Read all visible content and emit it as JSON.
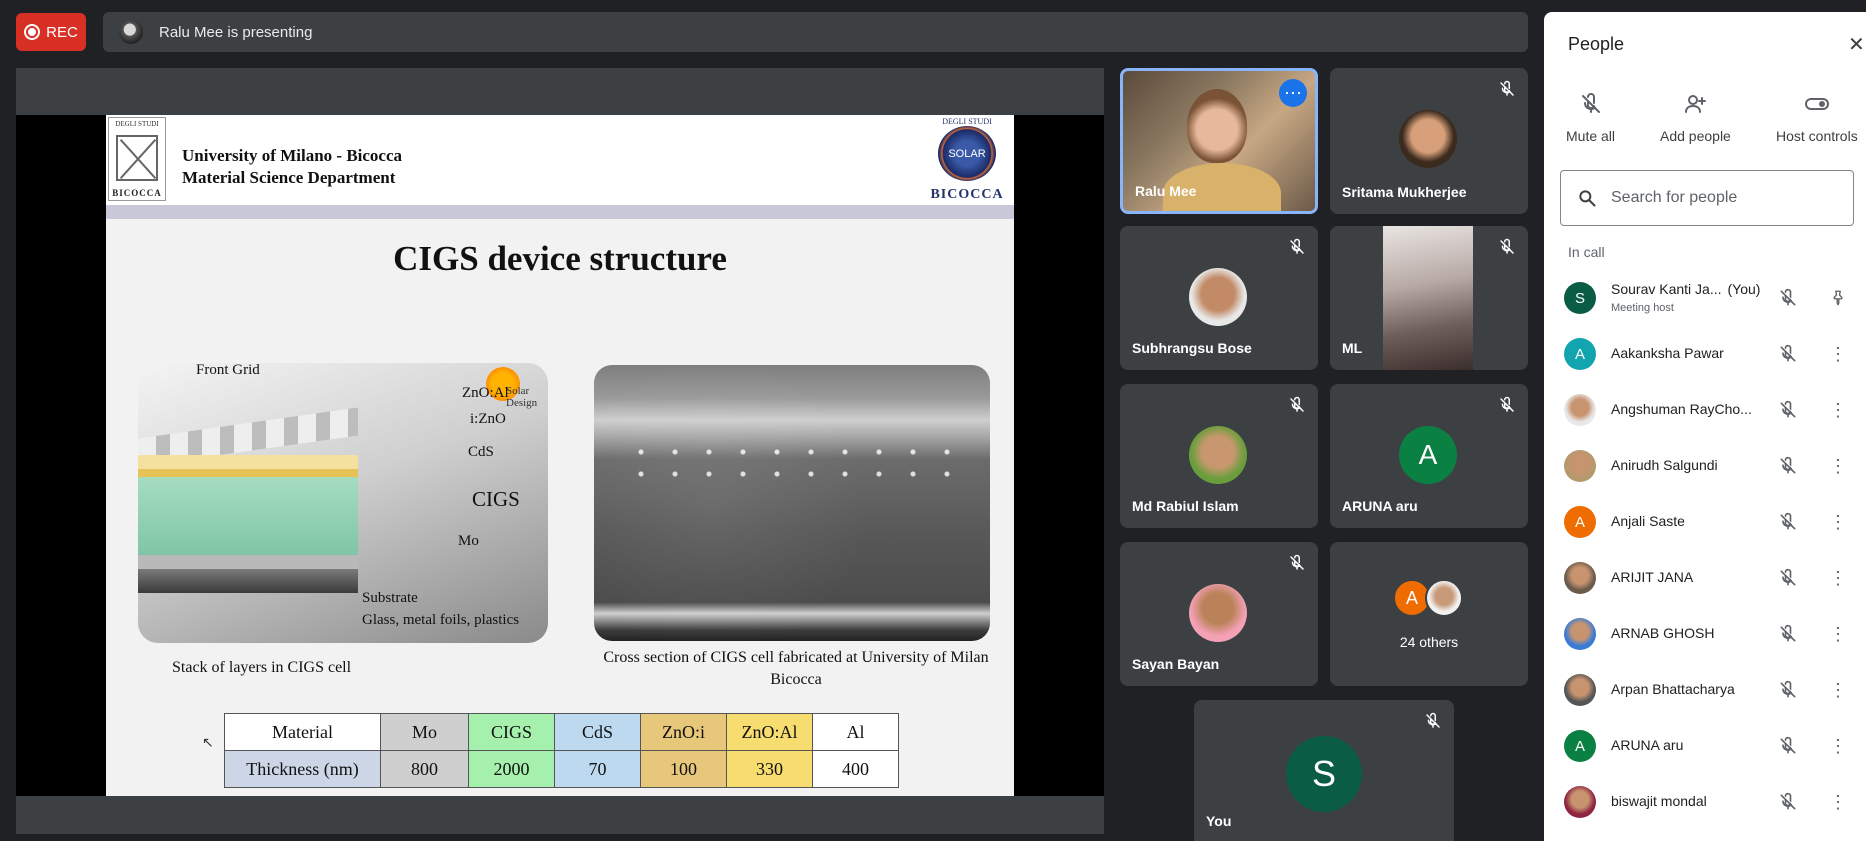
{
  "top_bar": {
    "rec_label": "REC",
    "presenting_text": "Ralu Mee is presenting"
  },
  "slide": {
    "university": "University of Milano - Bicocca",
    "department": "Material Science Department",
    "logo_left_top": "DEGLI STUDI",
    "logo_left_text": "BICOCCA",
    "logo_right_top": "DEGLI STUDI",
    "logo_right_circle": "SOLAR",
    "logo_right_text": "BICOCCA",
    "title": "CIGS device structure",
    "stack_labels": {
      "front_grid": "Front Grid",
      "zno_al": "ZnO:Al",
      "izno": "i:ZnO",
      "cds": "CdS",
      "cigs": "CIGS",
      "mo": "Mo",
      "substrate": "Substrate",
      "substrate_detail": "Glass, metal foils, plastics",
      "solar_design": "Solar Design"
    },
    "caption_left": "Stack of layers in CIGS cell",
    "caption_right": "Cross section of CIGS cell fabricated at University of Milan Bicocca",
    "table": {
      "header": [
        "Material",
        "Mo",
        "CIGS",
        "CdS",
        "ZnO:i",
        "ZnO:Al",
        "Al"
      ],
      "row": [
        "Thickness (nm)",
        "800",
        "2000",
        "70",
        "100",
        "330",
        "400"
      ]
    }
  },
  "tiles": {
    "ralu": "Ralu Mee",
    "sritama": "Sritama Mukherjee",
    "subhrangsu": "Subhrangsu Bose",
    "ml": "ML",
    "rabiul": "Md Rabiul Islam",
    "aruna": "ARUNA aru",
    "aruna_initial": "A",
    "sayan": "Sayan Bayan",
    "others_initial": "A",
    "others": "24 others",
    "you": "You",
    "you_initial": "S"
  },
  "panel": {
    "title": "People",
    "actions": [
      "Mute all",
      "Add people",
      "Host controls"
    ],
    "search_placeholder": "Search for people",
    "section": "In call",
    "people": [
      {
        "name": "Sourav Kanti Ja...",
        "tag": "(You)",
        "sub": "Meeting host",
        "initial": "S",
        "color": "#0b5c45"
      },
      {
        "name": "Aakanksha Pawar",
        "initial": "A",
        "color": "#12a4af"
      },
      {
        "name": "Angshuman RayCho...",
        "initial": "",
        "color": "#e8e8e8"
      },
      {
        "name": "Anirudh Salgundi",
        "initial": "",
        "color": "#b59a6e"
      },
      {
        "name": "Anjali Saste",
        "initial": "A",
        "color": "#ef6c00"
      },
      {
        "name": "ARIJIT JANA",
        "initial": "",
        "color": "#6b5b4b"
      },
      {
        "name": "ARNAB GHOSH",
        "initial": "",
        "color": "#3a7bd5"
      },
      {
        "name": "Arpan Bhattacharya",
        "initial": "",
        "color": "#555"
      },
      {
        "name": "ARUNA aru",
        "initial": "A",
        "color": "#0b8043"
      },
      {
        "name": "biswajit mondal",
        "initial": "",
        "color": "#8e2442"
      }
    ]
  }
}
